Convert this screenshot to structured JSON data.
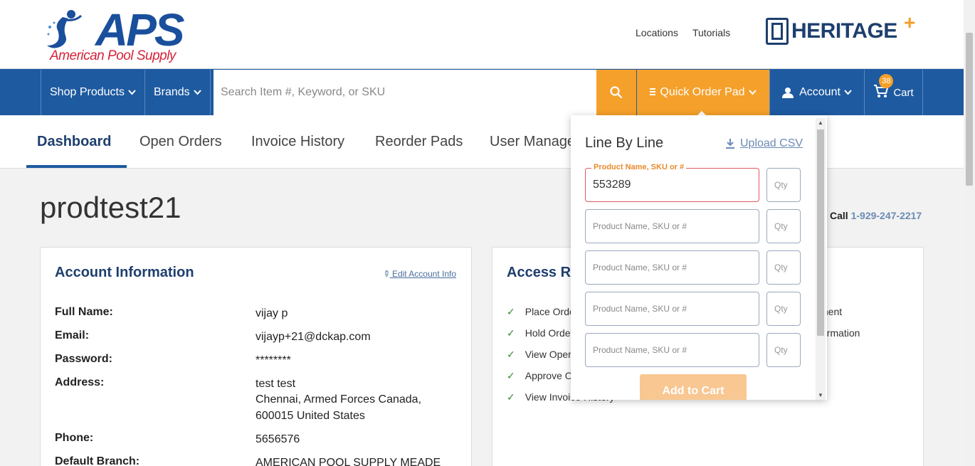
{
  "header": {
    "logo_text": "APS",
    "logo_tagline": "American Pool Supply",
    "links": [
      "Locations",
      "Tutorials"
    ],
    "partner_logo": "HERITAGE"
  },
  "nav": {
    "shop_products": "Shop Products",
    "brands": "Brands",
    "search_placeholder": "Search Item #, Keyword, or SKU",
    "quick_order_pad": "Quick Order Pad",
    "account": "Account",
    "cart": "Cart",
    "cart_count": "38",
    "icons": {
      "search": "search-icon",
      "chevron": "chevron-down-icon",
      "user": "user-icon",
      "cart": "cart-icon",
      "list": "list-icon"
    }
  },
  "tabs": [
    "Dashboard",
    "Open Orders",
    "Invoice History",
    "Reorder Pads",
    "User Manage"
  ],
  "page": {
    "title": "prodtest21",
    "call_label": "Call",
    "call_phone": "1-929-247-2217"
  },
  "account_info": {
    "title": "Account Information",
    "edit_link": "Edit Account Info",
    "rows": [
      {
        "label": "Full Name:",
        "value": "vijay p"
      },
      {
        "label": "Email:",
        "value": "vijayp+21@dckap.com"
      },
      {
        "label": "Password:",
        "value": "********"
      },
      {
        "label": "Address:",
        "value": "test test"
      },
      {
        "label": "",
        "value": "Chennai, Armed Forces Canada,"
      },
      {
        "label": "",
        "value": "600015 United States"
      },
      {
        "label": "Phone:",
        "value": "5656576"
      },
      {
        "label": "Default Branch:",
        "value": "AMERICAN POOL SUPPLY MEADE"
      }
    ]
  },
  "access_rights": {
    "title": "Access Ri",
    "items": [
      "Place Orde",
      "Hold Orde",
      "View Oper",
      "Approve O",
      "View Invoice History"
    ],
    "right_items": [
      "ment",
      "ormation"
    ]
  },
  "quick_order_pad": {
    "title": "Line By Line",
    "upload_csv": "Upload CSV",
    "sku_label": "Product Name, SKU or #",
    "sku_placeholder": "Product Name, SKU or #",
    "qty_placeholder": "Qty",
    "first_value": "553289",
    "add_to_cart": "Add to Cart"
  },
  "colors": {
    "brand_blue": "#1e5aa0",
    "accent_orange": "#f5a02a",
    "navy": "#1e3f6e"
  }
}
